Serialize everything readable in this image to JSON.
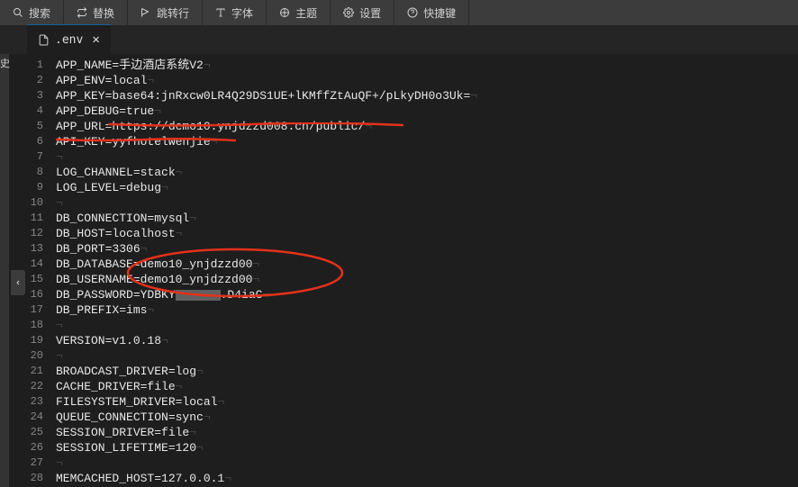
{
  "toolbar": [
    {
      "id": "search",
      "label": "搜索"
    },
    {
      "id": "replace",
      "label": "替换"
    },
    {
      "id": "goto",
      "label": "跳转行"
    },
    {
      "id": "font",
      "label": "字体"
    },
    {
      "id": "theme",
      "label": "主题"
    },
    {
      "id": "settings",
      "label": "设置"
    },
    {
      "id": "shortcut",
      "label": "快捷键"
    }
  ],
  "tab": {
    "filename": ".env"
  },
  "sidebar_hint": "史",
  "code_lines": [
    "APP_NAME=手边酒店系统V2",
    "APP_ENV=local",
    "APP_KEY=base64:jnRxcw0LR4Q29DS1UE+lKMffZtAuQF+/pLkyDH0o3Uk=",
    "APP_DEBUG=true",
    "APP_URL=https://demo10.ynjdzzd008.cn/public/",
    "API_KEY=yyfhotelwenjie",
    "",
    "LOG_CHANNEL=stack",
    "LOG_LEVEL=debug",
    "",
    "DB_CONNECTION=mysql",
    "DB_HOST=localhost",
    "DB_PORT=3306",
    "DB_DATABASE=demo10_ynjdzzd00",
    "DB_USERNAME=demo10_ynjdzzd00",
    "DB_PASSWORD=YDBKY██████.D4iaC",
    "DB_PREFIX=ims",
    "",
    "VERSION=v1.0.18",
    "",
    "BROADCAST_DRIVER=log",
    "CACHE_DRIVER=file",
    "FILESYSTEM_DRIVER=local",
    "QUEUE_CONNECTION=sync",
    "SESSION_DRIVER=file",
    "SESSION_LIFETIME=120",
    "",
    "MEMCACHED_HOST=127.0.0.1"
  ],
  "annotation_color": "#e4311a"
}
